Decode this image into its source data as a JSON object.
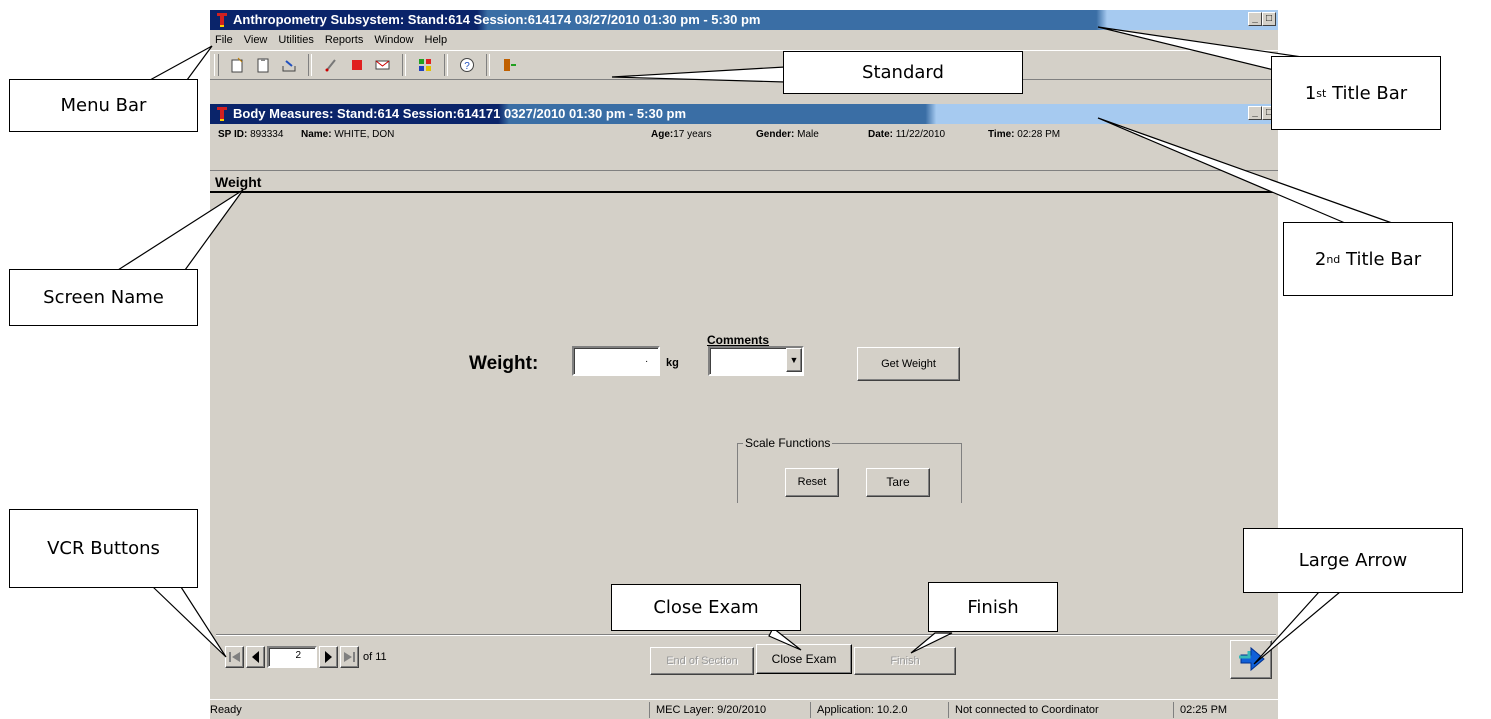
{
  "window": {
    "title": "Anthropometry Subsystem: Stand:614 Session:614174 03/27/2010 01:30 pm - 5:30 pm",
    "menu": [
      "File",
      "View",
      "Utilities",
      "Reports",
      "Window",
      "Help"
    ],
    "toolbar_icons": [
      "new-doc-icon",
      "clipboard-icon",
      "tray-icon",
      "link-icon",
      "stop-icon",
      "envelope-icon",
      "chart-icon",
      "help-icon",
      "exit-icon"
    ]
  },
  "child": {
    "title": "Body Measures: Stand:614 Session:614171 0327/2010 01:30 pm - 5:30 pm",
    "patient": {
      "sp_id_label": "SP ID:",
      "sp_id": "893334",
      "name_label": "Name:",
      "name": "WHITE, DON",
      "age_label": "Age:",
      "age": "17 years",
      "gender_label": "Gender:",
      "gender": "Male",
      "date_label": "Date:",
      "date": "11/22/2010",
      "time_label": "Time:",
      "time": "02:28 PM"
    },
    "screen_name": "Weight"
  },
  "form": {
    "weight_label": "Weight:",
    "weight_value": ".",
    "unit": "kg",
    "comments_label": "Comments",
    "comments_value": "",
    "get_weight": "Get Weight",
    "scale_functions": "Scale Functions",
    "reset": "Reset",
    "tare": "Tare"
  },
  "nav": {
    "page": "2",
    "of_total": "of 11",
    "end_of_section": "End of Section",
    "close_exam": "Close Exam",
    "finish": "Finish"
  },
  "status": {
    "ready": "Ready",
    "mec_layer": "MEC Layer: 9/20/2010",
    "application": "Application: 10.2.0",
    "connection": "Not connected to Coordinator",
    "clock": "02:25 PM"
  },
  "callouts": {
    "menu_bar": "Menu Bar",
    "standard": "Standard",
    "title1_pre": "1",
    "title1_sup": "st",
    "title1_post": " Title Bar",
    "title2_pre": "2",
    "title2_sup": "nd",
    "title2_post": " Title Bar",
    "screen_name": "Screen Name",
    "vcr_buttons": "VCR Buttons",
    "close_exam": "Close Exam",
    "finish": "Finish",
    "large_arrow": "Large Arrow"
  },
  "colors": {
    "title_active": "#0a246a",
    "title_mid": "#3a6ea5",
    "title_light": "#a6caf0",
    "face": "#d4d0c8"
  }
}
